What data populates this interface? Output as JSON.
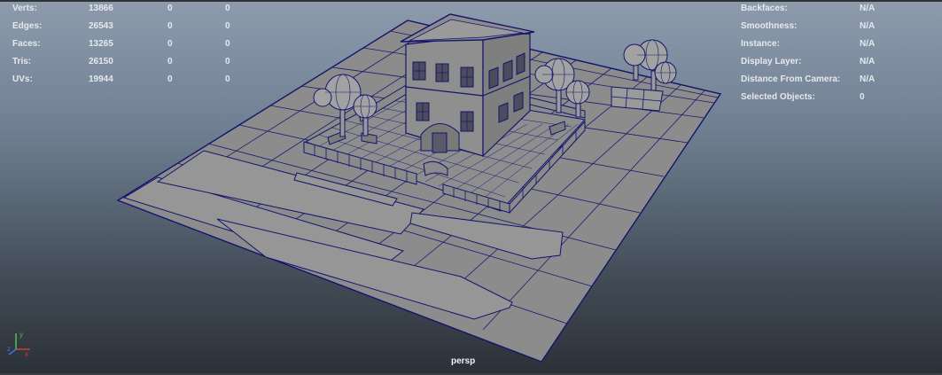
{
  "hud_left": {
    "rows": [
      {
        "label": "Verts:",
        "value": "13866",
        "selected": "0",
        "component": "0"
      },
      {
        "label": "Edges:",
        "value": "26543",
        "selected": "0",
        "component": "0"
      },
      {
        "label": "Faces:",
        "value": "13265",
        "selected": "0",
        "component": "0"
      },
      {
        "label": "Tris:",
        "value": "26150",
        "selected": "0",
        "component": "0"
      },
      {
        "label": "UVs:",
        "value": "19944",
        "selected": "0",
        "component": "0"
      }
    ]
  },
  "hud_right": {
    "rows": [
      {
        "label": "Backfaces:",
        "value": "N/A"
      },
      {
        "label": "Smoothness:",
        "value": "N/A"
      },
      {
        "label": "Instance:",
        "value": "N/A"
      },
      {
        "label": "Display Layer:",
        "value": "N/A"
      },
      {
        "label": "Distance From Camera:",
        "value": "N/A"
      },
      {
        "label": "Selected Objects:",
        "value": "0"
      }
    ]
  },
  "viewport": {
    "camera": "persp",
    "axis": {
      "x": "x",
      "y": "y",
      "z": "z"
    },
    "wire_color": "#14146e",
    "ground_color": "#8c8c8c"
  }
}
